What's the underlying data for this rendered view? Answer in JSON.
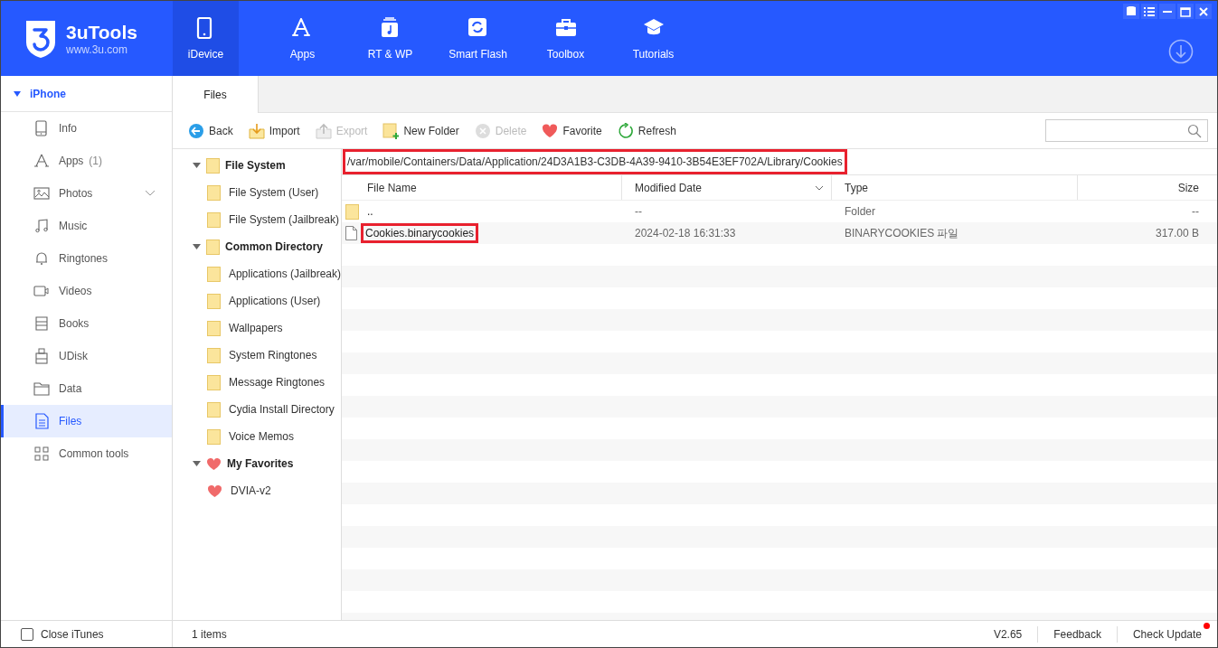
{
  "app": {
    "name": "3uTools",
    "site": "www.3u.com"
  },
  "nav": [
    {
      "label": "iDevice",
      "selected": true
    },
    {
      "label": "Apps",
      "selected": false
    },
    {
      "label": "RT & WP",
      "selected": false
    },
    {
      "label": "Smart Flash",
      "selected": false
    },
    {
      "label": "Toolbox",
      "selected": false
    },
    {
      "label": "Tutorials",
      "selected": false
    }
  ],
  "device": {
    "name": "iPhone",
    "expanded": true
  },
  "sidebar": {
    "items": [
      {
        "label": "Info",
        "selected": false
      },
      {
        "label": "Apps",
        "count": "(1)",
        "selected": false
      },
      {
        "label": "Photos",
        "expandable": true,
        "selected": false
      },
      {
        "label": "Music",
        "selected": false
      },
      {
        "label": "Ringtones",
        "selected": false
      },
      {
        "label": "Videos",
        "selected": false
      },
      {
        "label": "Books",
        "selected": false
      },
      {
        "label": "UDisk",
        "selected": false
      },
      {
        "label": "Data",
        "selected": false
      },
      {
        "label": "Files",
        "selected": true
      },
      {
        "label": "Common tools",
        "selected": false
      }
    ]
  },
  "tabs": [
    {
      "label": "Files",
      "selected": true
    }
  ],
  "toolbar": [
    {
      "label": "Back",
      "disabled": false
    },
    {
      "label": "Import",
      "disabled": false
    },
    {
      "label": "Export",
      "disabled": true
    },
    {
      "label": "New Folder",
      "disabled": false
    },
    {
      "label": "Delete",
      "disabled": true
    },
    {
      "label": "Favorite",
      "disabled": false
    },
    {
      "label": "Refresh",
      "disabled": false
    }
  ],
  "tree": [
    {
      "label": "File System",
      "kind": "folder",
      "expanded": true,
      "children": [
        {
          "label": "File System (User)",
          "kind": "folder"
        },
        {
          "label": "File System (Jailbreak)",
          "kind": "folder"
        }
      ]
    },
    {
      "label": "Common Directory",
      "kind": "folder",
      "expanded": true,
      "children": [
        {
          "label": "Applications (Jailbreak)",
          "kind": "folder"
        },
        {
          "label": "Applications (User)",
          "kind": "folder"
        },
        {
          "label": "Wallpapers",
          "kind": "folder"
        },
        {
          "label": "System Ringtones",
          "kind": "folder"
        },
        {
          "label": "Message Ringtones",
          "kind": "folder"
        },
        {
          "label": "Cydia Install Directory",
          "kind": "folder"
        },
        {
          "label": "Voice Memos",
          "kind": "folder"
        }
      ]
    },
    {
      "label": "My Favorites",
      "kind": "heart",
      "expanded": true,
      "children": [
        {
          "label": "DVIA-v2",
          "kind": "heart"
        }
      ]
    }
  ],
  "path": {
    "value": "/var/mobile/Containers/Data/Application/24D3A1B3-C3DB-4A39-9410-3B54E3EF702A/Library/Cookies",
    "highlighted": true
  },
  "table": {
    "columns": [
      {
        "label": "File Name"
      },
      {
        "label": "Modified Date",
        "sorted": true
      },
      {
        "label": "Type"
      },
      {
        "label": "Size"
      }
    ],
    "rows": [
      {
        "kind": "folder",
        "name": "..",
        "modified": "--",
        "type": "Folder",
        "size": "--",
        "highlighted": false
      },
      {
        "kind": "file",
        "name": "Cookies.binarycookies",
        "modified": "2024-02-18 16:31:33",
        "type": "BINARYCOOKIES 파일",
        "size": "317.00 B",
        "highlighted": true
      }
    ]
  },
  "status_bar": {
    "close_itunes": {
      "label": "Close iTunes",
      "checked": false
    },
    "items": "1 items",
    "version": "V2.65",
    "feedback": "Feedback",
    "check_update": {
      "label": "Check Update",
      "has_update": true
    }
  }
}
